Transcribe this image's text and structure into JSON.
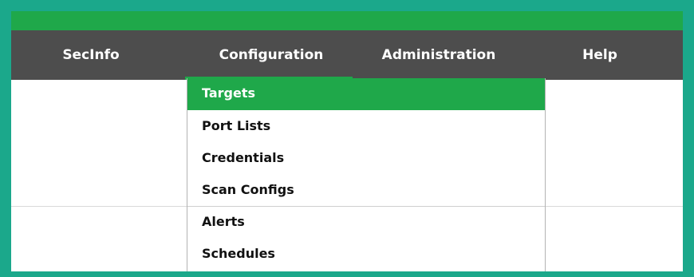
{
  "nav": {
    "items": [
      {
        "label": "SecInfo"
      },
      {
        "label": "Configuration"
      },
      {
        "label": "Administration"
      },
      {
        "label": "Help"
      }
    ],
    "active_index": 1
  },
  "dropdown": {
    "items": [
      {
        "label": "Targets"
      },
      {
        "label": "Port Lists"
      },
      {
        "label": "Credentials"
      },
      {
        "label": "Scan Configs"
      },
      {
        "label": "Alerts"
      },
      {
        "label": "Schedules"
      }
    ],
    "highlighted_index": 0
  },
  "colors": {
    "frame": "#1ba88b",
    "accent_green": "#1fa84a",
    "navbar": "#4d4d4d",
    "menu_text": "#111111"
  }
}
